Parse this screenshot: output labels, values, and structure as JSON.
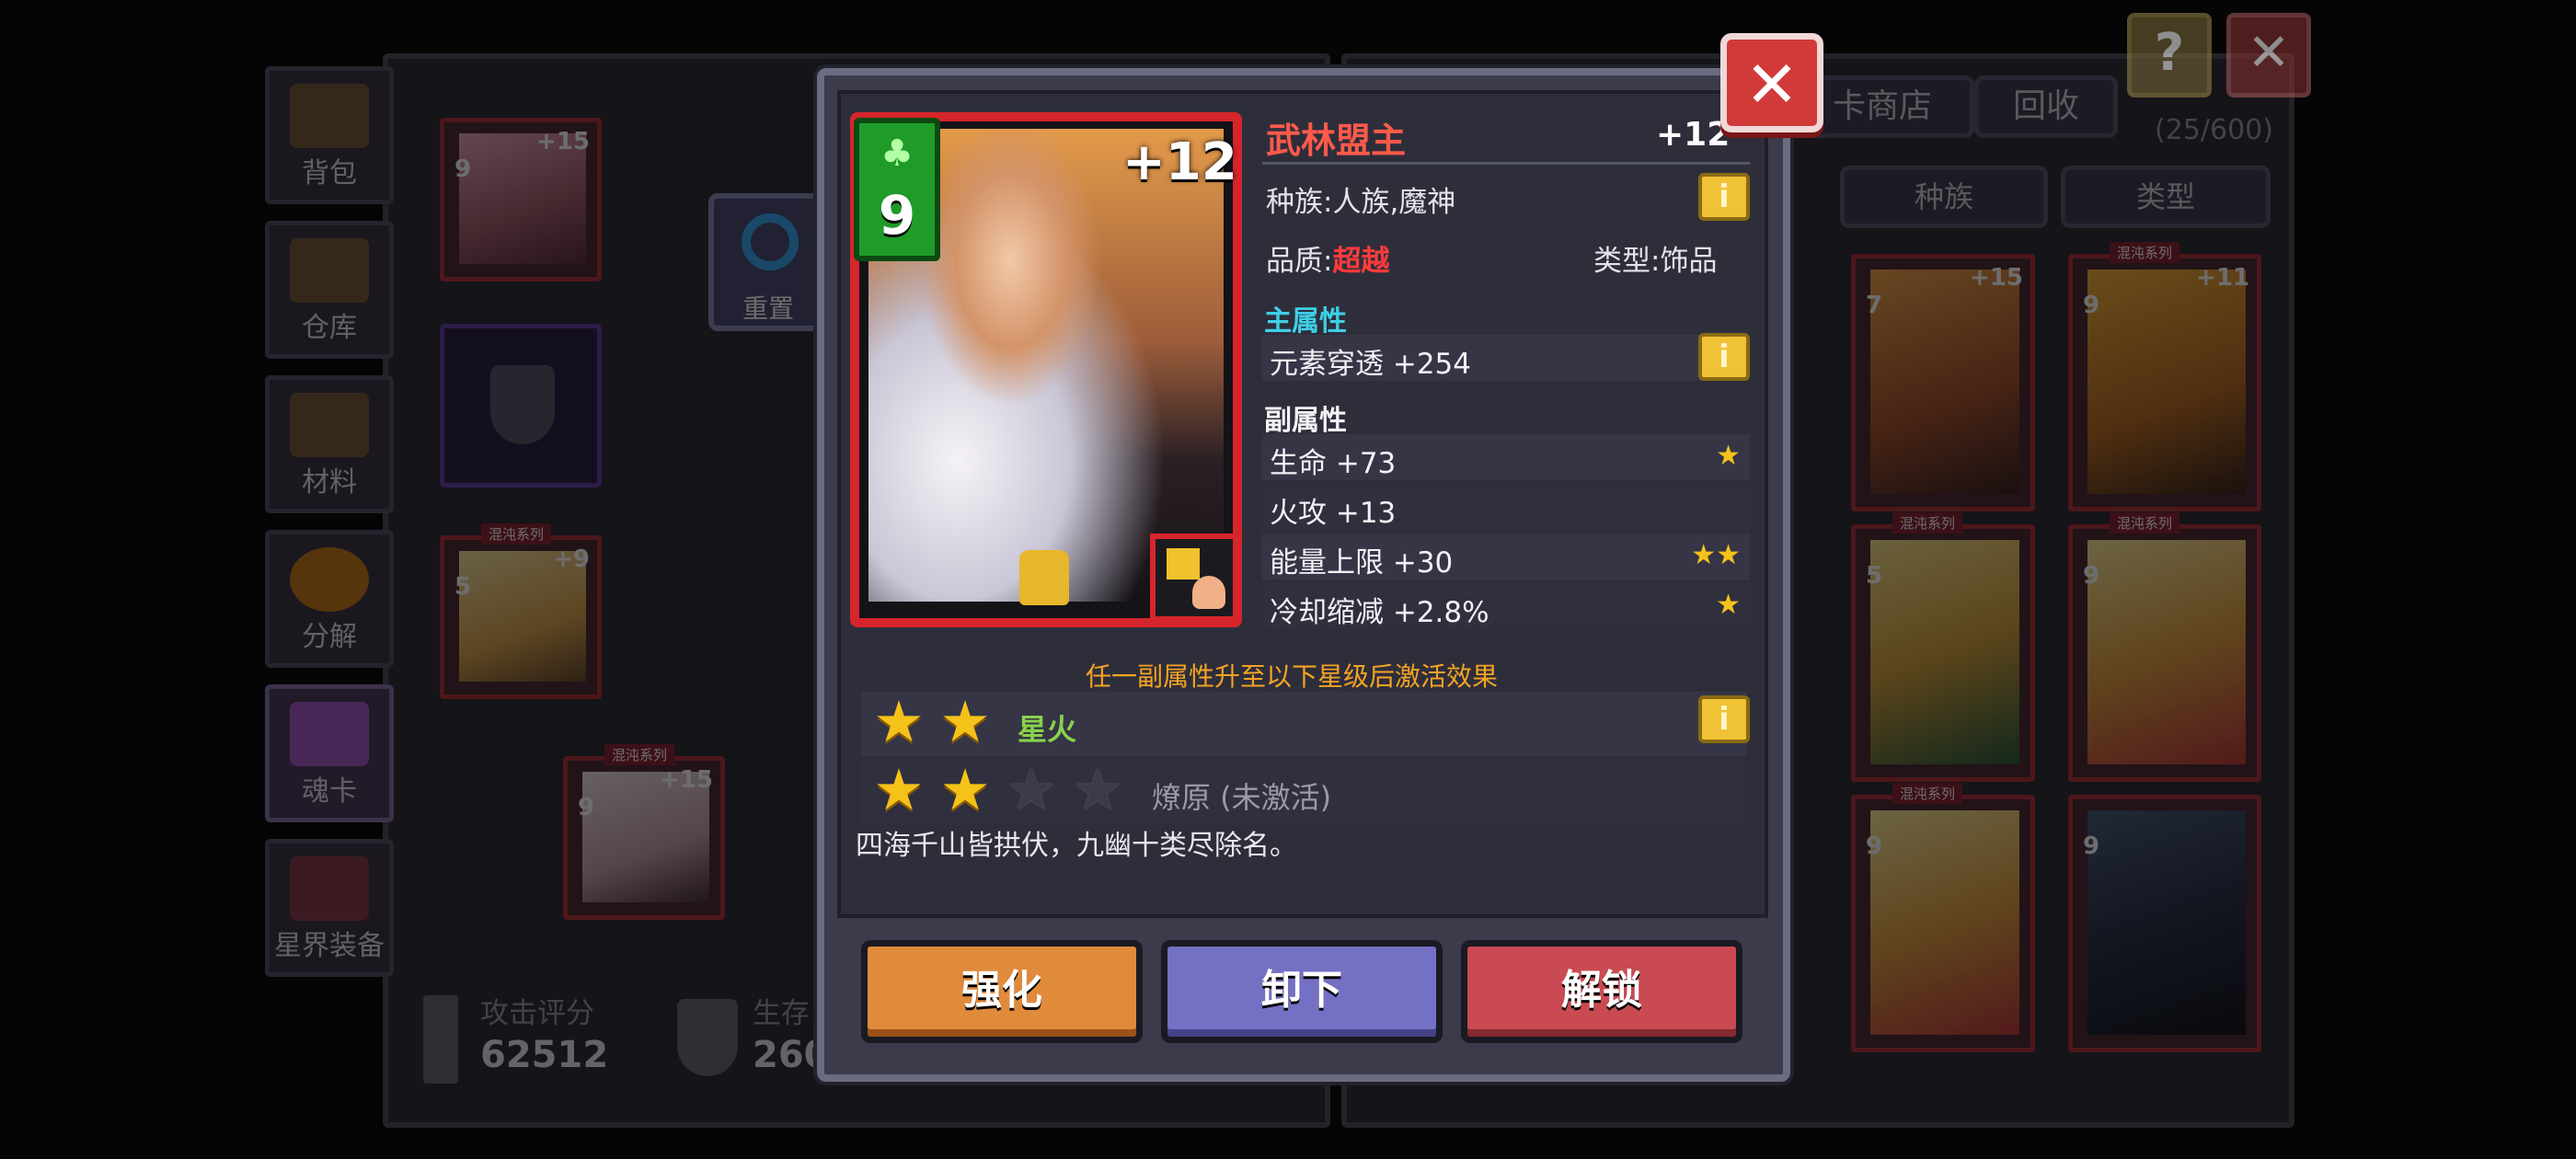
{
  "background": {
    "sidebar": [
      {
        "label": "背包"
      },
      {
        "label": "仓库"
      },
      {
        "label": "材料"
      },
      {
        "label": "分解"
      },
      {
        "label": "魂卡"
      },
      {
        "label": "星界装备"
      }
    ],
    "reset_label": "重置",
    "top_tabs": [
      "卡商店",
      "回收"
    ],
    "capacity": "(25/600)",
    "filters": [
      "种族",
      "类型"
    ],
    "attack_score_label": "攻击评分",
    "attack_score_value": "62512",
    "hp_score_label": "生存",
    "hp_score_value": "260",
    "left_cards": [
      {
        "num": "9",
        "plus": "+15"
      },
      {
        "num": "5",
        "plus": "+9",
        "tag": "混沌系列"
      },
      {
        "num": "9",
        "plus": "+15",
        "tag": "混沌系列"
      }
    ],
    "right_cards": [
      {
        "num": "7",
        "plus": "+15"
      },
      {
        "num": "9",
        "plus": "+11",
        "tag": "混沌系列"
      },
      {
        "num": "5",
        "tag": "混沌系列"
      },
      {
        "num": "9",
        "tag": "混沌系列"
      },
      {
        "num": "9",
        "tag": "混沌系列"
      },
      {
        "num": "9"
      }
    ]
  },
  "card": {
    "element_level": "9",
    "enhance_level": "+12"
  },
  "detail": {
    "name": "武林盟主",
    "level": "+12",
    "race": "种族:人族,魔神",
    "quality_label": "品质:",
    "quality_value": "超越",
    "type_label": "类型:",
    "type_value": "饰品",
    "main_title": "主属性",
    "main_stat": "元素穿透 +254",
    "sub_title": "副属性",
    "sub_stats": [
      {
        "text": "生命 +73",
        "stars": "★"
      },
      {
        "text": "火攻 +13",
        "stars": ""
      },
      {
        "text": "能量上限 +30",
        "stars": "★★"
      },
      {
        "text": "冷却缩减 +2.8%",
        "stars": "★"
      }
    ],
    "activate_hint": "任一副属性升至以下星级后激活效果",
    "set_effects": [
      {
        "name": "星火",
        "stars_on": 2,
        "stars_total": 2,
        "active": true
      },
      {
        "name": "燎原 (未激活)",
        "stars_on": 2,
        "stars_total": 4,
        "active": false
      }
    ],
    "flavor": "四海千山皆拱伏，九幽十类尽除名。"
  },
  "buttons": {
    "enhance": "强化",
    "unequip": "卸下",
    "unlock": "解锁"
  },
  "colors": {
    "name_red": "#ff5a4a",
    "quality_red": "#ff3b3b",
    "main_title_teal": "#3ecfe6",
    "set_active_green": "#8ad14a",
    "star_gold": "#f5c21a",
    "enhance_btn": "#e08a3c",
    "unequip_btn": "#7470c4",
    "unlock_btn": "#c94a52"
  }
}
